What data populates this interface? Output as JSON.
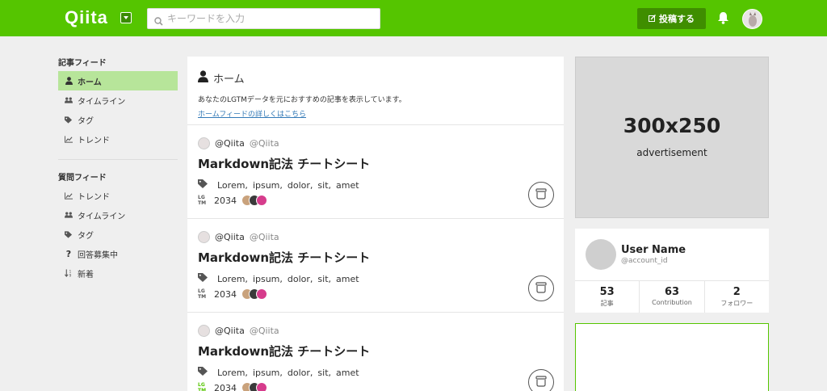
{
  "header": {
    "logo": "Qiita",
    "search_placeholder": "キーワードを入力",
    "post_button": "投稿する",
    "colors": {
      "brand": "#55c500",
      "post_button_bg": "#3f8e00"
    }
  },
  "sidebar": {
    "article_feed": {
      "heading": "記事フィード",
      "items": [
        {
          "label": "ホーム",
          "icon": "user-icon",
          "active": true
        },
        {
          "label": "タイムライン",
          "icon": "users-icon"
        },
        {
          "label": "タグ",
          "icon": "tags-icon"
        },
        {
          "label": "トレンド",
          "icon": "chart-icon"
        }
      ]
    },
    "question_feed": {
      "heading": "質問フィード",
      "items": [
        {
          "label": "トレンド",
          "icon": "chart-icon"
        },
        {
          "label": "タイムライン",
          "icon": "users-icon"
        },
        {
          "label": "タグ",
          "icon": "tags-icon"
        },
        {
          "label": "回答募集中",
          "icon": "question-icon"
        },
        {
          "label": "新着",
          "icon": "sort-icon"
        }
      ]
    }
  },
  "feed": {
    "title": "ホーム",
    "description": "あなたのLGTMデータを元におすすめの記事を表示しています。",
    "link": "ホームフィードの詳しくはこちら",
    "articles": [
      {
        "user_id": "@Qiita",
        "user_name": "@Qiita",
        "title": "Markdown記法 チートシート",
        "tags": [
          "Lorem,",
          "ipsum,",
          "dolor,",
          "sit,",
          "amet"
        ],
        "lgtm_label": "LGTM",
        "lgtm_count": "2034"
      },
      {
        "user_id": "@Qiita",
        "user_name": "@Qiita",
        "title": "Markdown記法 チートシート",
        "tags": [
          "Lorem,",
          "ipsum,",
          "dolor,",
          "sit,",
          "amet"
        ],
        "lgtm_label": "LGTM",
        "lgtm_count": "2034"
      },
      {
        "user_id": "@Qiita",
        "user_name": "@Qiita",
        "title": "Markdown記法 チートシート",
        "tags": [
          "Lorem,",
          "ipsum,",
          "dolor,",
          "sit,",
          "amet"
        ],
        "lgtm_label": "LGTM",
        "lgtm_count": "2034"
      }
    ]
  },
  "ad": {
    "size": "300x250",
    "label": "advertisement"
  },
  "user_card": {
    "name": "User Name",
    "account_id": "@account_id",
    "stats": [
      {
        "value": "53",
        "label": "記事"
      },
      {
        "value": "63",
        "label": "Contribution"
      },
      {
        "value": "2",
        "label": "フォロワー"
      }
    ]
  }
}
